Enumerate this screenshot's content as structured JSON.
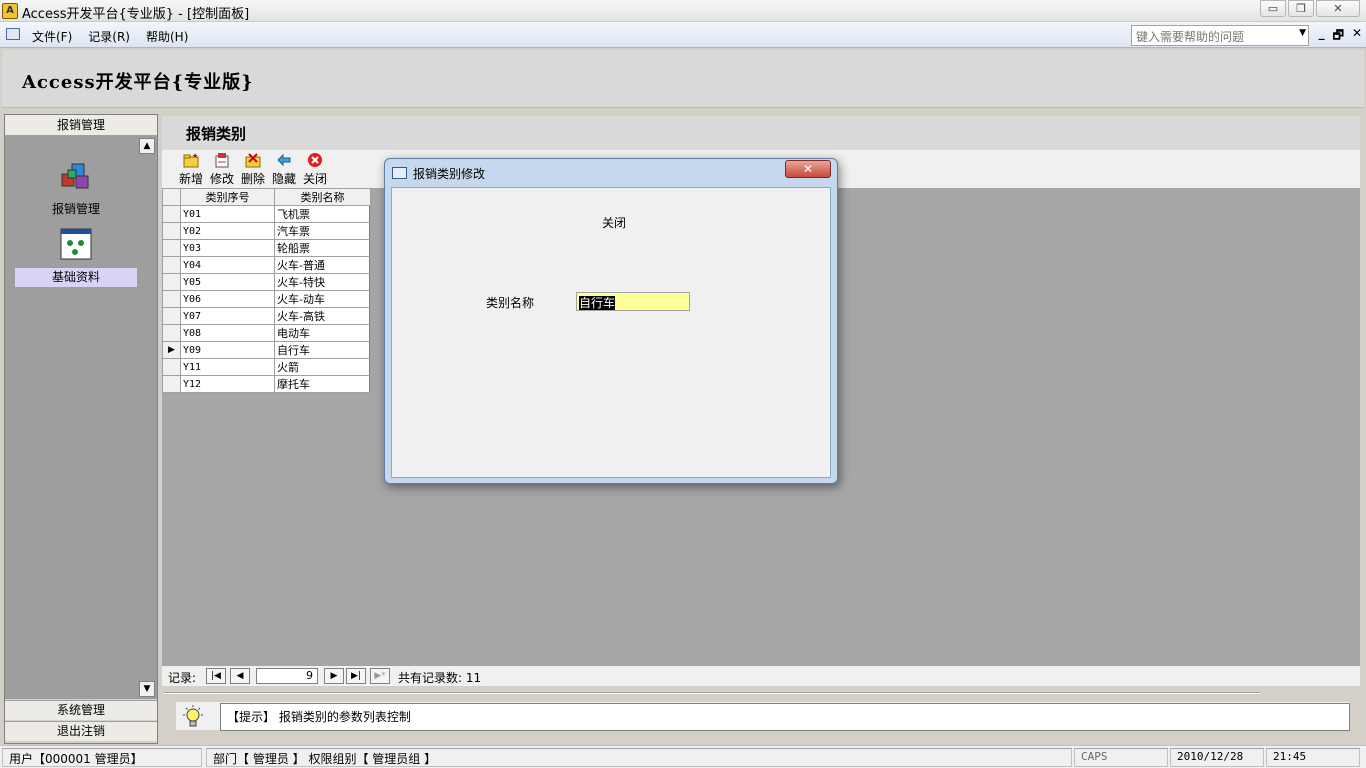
{
  "window": {
    "title": "Access开发平台{专业版} - [控制面板]",
    "min_glyph": "▭",
    "max_glyph": "❐",
    "close_glyph": "✕"
  },
  "menu": {
    "items": [
      "文件(F)",
      "记录(R)",
      "帮助(H)"
    ],
    "help_placeholder": "键入需要帮助的问题",
    "mdi_min": "_",
    "mdi_restore": "🗗",
    "mdi_close": "✕"
  },
  "header": {
    "app_title": "Access开发平台{专业版}"
  },
  "leftnav": {
    "top_section": "报销管理",
    "items": [
      {
        "label": "报销管理",
        "icon": "cubes-icon"
      },
      {
        "label": "基础资料",
        "icon": "dots-window-icon"
      }
    ],
    "bottom_sections": [
      "系统管理",
      "退出注销"
    ]
  },
  "main": {
    "page_title": "报销类别",
    "toolbar": [
      {
        "label": "新增",
        "icon": "new-folder-icon"
      },
      {
        "label": "修改",
        "icon": "edit-icon"
      },
      {
        "label": "删除",
        "icon": "delete-icon"
      },
      {
        "label": "隐藏",
        "icon": "back-arrow-icon"
      },
      {
        "label": "关闭",
        "icon": "close-circle-icon"
      }
    ],
    "grid": {
      "columns": [
        "类别序号",
        "类别名称"
      ],
      "rows": [
        [
          "Y01",
          "飞机票"
        ],
        [
          "Y02",
          "汽车票"
        ],
        [
          "Y03",
          "轮船票"
        ],
        [
          "Y04",
          "火车-普通"
        ],
        [
          "Y05",
          "火车-特快"
        ],
        [
          "Y06",
          "火车-动车"
        ],
        [
          "Y07",
          "火车-高铁"
        ],
        [
          "Y08",
          "电动车"
        ],
        [
          "Y09",
          "自行车"
        ],
        [
          "Y11",
          "火箭"
        ],
        [
          "Y12",
          "摩托车"
        ]
      ],
      "current_row_index": 8
    },
    "record_nav": {
      "label": "记录:",
      "current": "9",
      "count_text": "共有记录数: 11"
    },
    "hint": "【提示】 报销类别的参数列表控制"
  },
  "dialog": {
    "title": "报销类别修改",
    "close_text": "关闭",
    "field_label": "类别名称",
    "field_value": "自行车"
  },
  "status": {
    "user": "用户【000001 管理员】",
    "dept": "部门【 管理员 】 权限组别【 管理员组 】",
    "caps": "CAPS",
    "date": "2010/12/28",
    "time": "21:45"
  },
  "colors": {
    "selected_nav": "#d9d3f5",
    "input_highlight": "#ffff99",
    "dialog_close": "#c8483a"
  }
}
